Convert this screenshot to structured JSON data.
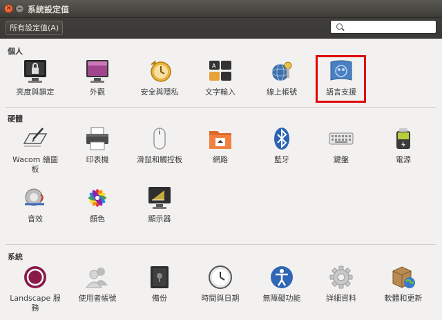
{
  "window": {
    "title": "系統設定值"
  },
  "toolbar": {
    "all_settings_label": "所有設定值(A)",
    "search_placeholder": ""
  },
  "sections": {
    "personal": {
      "title": "個人",
      "items": [
        "亮度與鎖定",
        "外觀",
        "安全與隱私",
        "文字輸入",
        "線上帳號",
        "語言支援"
      ]
    },
    "hardware": {
      "title": "硬體",
      "items": [
        "Wacom 繪圖\n板",
        "印表機",
        "滑鼠和觸控板",
        "網路",
        "藍牙",
        "鍵盤",
        "電源",
        "音效",
        "顏色",
        "顯示器"
      ]
    },
    "system": {
      "title": "系統",
      "items": [
        "Landscape 服\n務",
        "使用者帳號",
        "備份",
        "時間與日期",
        "無障礙功能",
        "詳細資料",
        "軟體和更新"
      ]
    }
  },
  "highlighted_item": "語言支援",
  "colors": {
    "highlight": "#e00000",
    "titlebar": "#3d3c37",
    "background": "#f2f1f0"
  }
}
